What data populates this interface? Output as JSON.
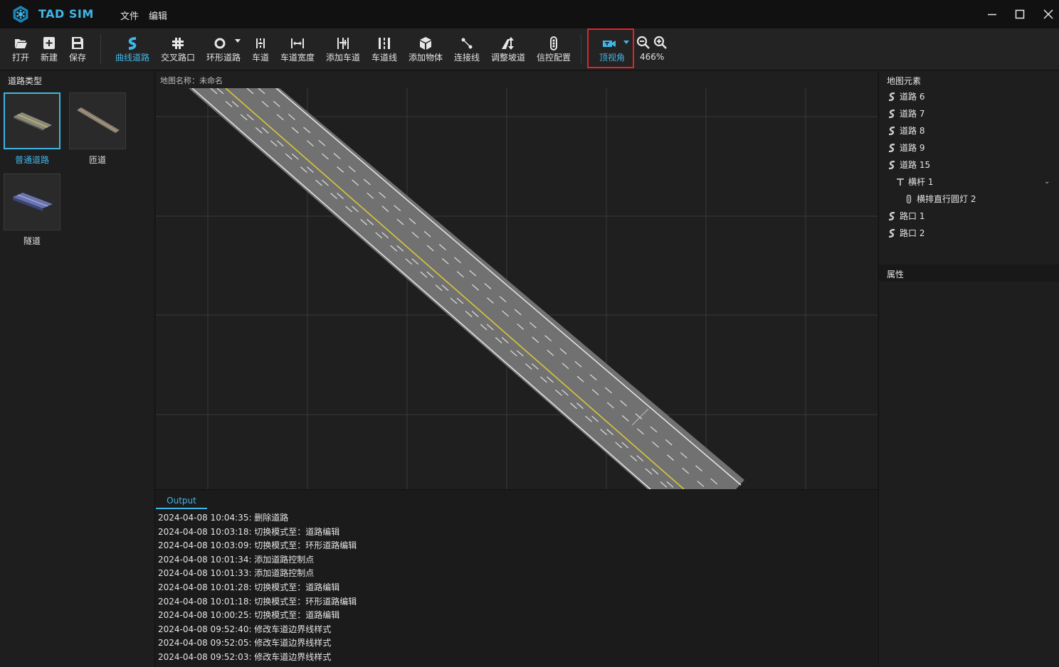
{
  "app": {
    "title": "TAD SIM",
    "accent": "#3fb6e8"
  },
  "menu": {
    "file": "文件",
    "edit": "编辑"
  },
  "toolbar": {
    "open": "打开",
    "new": "新建",
    "save": "保存",
    "curve_road": "曲线道路",
    "junction": "交叉路口",
    "roundabout": "环形道路",
    "lane": "车道",
    "lane_width": "车道宽度",
    "add_lane": "添加车道",
    "lane_line": "车道线",
    "add_object": "添加物体",
    "connect_line": "连接线",
    "adjust_slope": "调整坡道",
    "signal_config": "信控配置",
    "top_view": "顶视角",
    "zoom": "466%",
    "highlight_color": "#e0242c"
  },
  "left_panel": {
    "title": "道路类型",
    "cards": [
      {
        "label": "普通道路",
        "selected": true
      },
      {
        "label": "匝道",
        "selected": false
      },
      {
        "label": "隧道",
        "selected": false
      }
    ]
  },
  "canvas": {
    "map_name": "地图名称：未命名"
  },
  "output": {
    "tab": "Output",
    "lines": [
      "2024-04-08 10:04:35: 删除道路",
      "2024-04-08 10:03:18: 切换模式至：道路编辑",
      "2024-04-08 10:03:09: 切换模式至：环形道路编辑",
      "2024-04-08 10:01:34: 添加道路控制点",
      "2024-04-08 10:01:33: 添加道路控制点",
      "2024-04-08 10:01:28: 切换模式至：道路编辑",
      "2024-04-08 10:01:18: 切换模式至：环形道路编辑",
      "2024-04-08 10:00:25: 切换模式至：道路编辑",
      "2024-04-08 09:52:40: 修改车道边界线样式",
      "2024-04-08 09:52:05: 修改车道边界线样式",
      "2024-04-08 09:52:03: 修改车道边界线样式"
    ]
  },
  "right_panel": {
    "elements_title": "地图元素",
    "properties_title": "属性",
    "tree": [
      {
        "label": "道路 6",
        "icon": "road-icon"
      },
      {
        "label": "道路 7",
        "icon": "road-icon"
      },
      {
        "label": "道路 8",
        "icon": "road-icon"
      },
      {
        "label": "道路 9",
        "icon": "road-icon"
      },
      {
        "label": "道路 15",
        "icon": "road-icon"
      },
      {
        "label": "横杆 1",
        "icon": "pole-icon"
      },
      {
        "label": "横排直行圆灯 2",
        "icon": "traffic-light-icon"
      },
      {
        "label": "路口 1",
        "icon": "road-icon"
      },
      {
        "label": "路口 2",
        "icon": "road-icon"
      }
    ]
  }
}
